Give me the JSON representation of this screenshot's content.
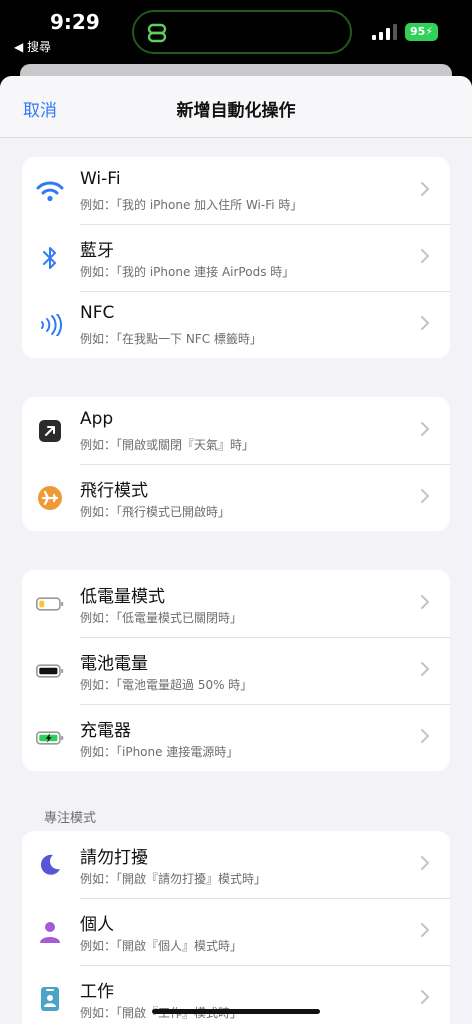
{
  "status": {
    "time": "9:29",
    "back_app": "◀ 搜尋",
    "battery": "95"
  },
  "nav": {
    "cancel": "取消",
    "title": "新增自動化操作"
  },
  "groups": [
    {
      "rows": [
        {
          "icon": "wifi-icon",
          "title": "Wi-Fi",
          "subtitle": "例如：「我的 iPhone 加入住所 Wi-Fi 時」"
        },
        {
          "icon": "bluetooth-icon",
          "title": "藍牙",
          "subtitle": "例如：「我的 iPhone 連接 AirPods 時」"
        },
        {
          "icon": "nfc-icon",
          "title": "NFC",
          "subtitle": "例如：「在我點一下 NFC 標籤時」"
        }
      ]
    },
    {
      "rows": [
        {
          "icon": "app-icon",
          "title": "App",
          "subtitle": "例如：「開啟或關閉『天氣』時」"
        },
        {
          "icon": "airplane-icon",
          "title": "飛行模式",
          "subtitle": "例如：「飛行模式已開啟時」"
        }
      ]
    },
    {
      "rows": [
        {
          "icon": "low-battery-icon",
          "title": "低電量模式",
          "subtitle": "例如：「低電量模式已關閉時」"
        },
        {
          "icon": "battery-icon",
          "title": "電池電量",
          "subtitle": "例如：「電池電量超過 50% 時」"
        },
        {
          "icon": "charger-icon",
          "title": "充電器",
          "subtitle": "例如：「iPhone 連接電源時」"
        }
      ]
    },
    {
      "label": "專注模式",
      "rows": [
        {
          "icon": "moon-icon",
          "title": "請勿打擾",
          "subtitle": "例如：「開啟『請勿打擾』模式時」"
        },
        {
          "icon": "person-icon",
          "title": "個人",
          "subtitle": "例如：「開啟『個人』模式時」"
        },
        {
          "icon": "badge-icon",
          "title": "工作",
          "subtitle": "例如：「開啟『工作』模式時」"
        }
      ]
    }
  ],
  "colors": {
    "accent": "#2f7bf6",
    "airplane": "#f09a37",
    "moon": "#5856d6",
    "person": "#a55bd6",
    "badge": "#4ba3c7",
    "low_battery": "#f7c631",
    "charging": "#2fd158"
  }
}
